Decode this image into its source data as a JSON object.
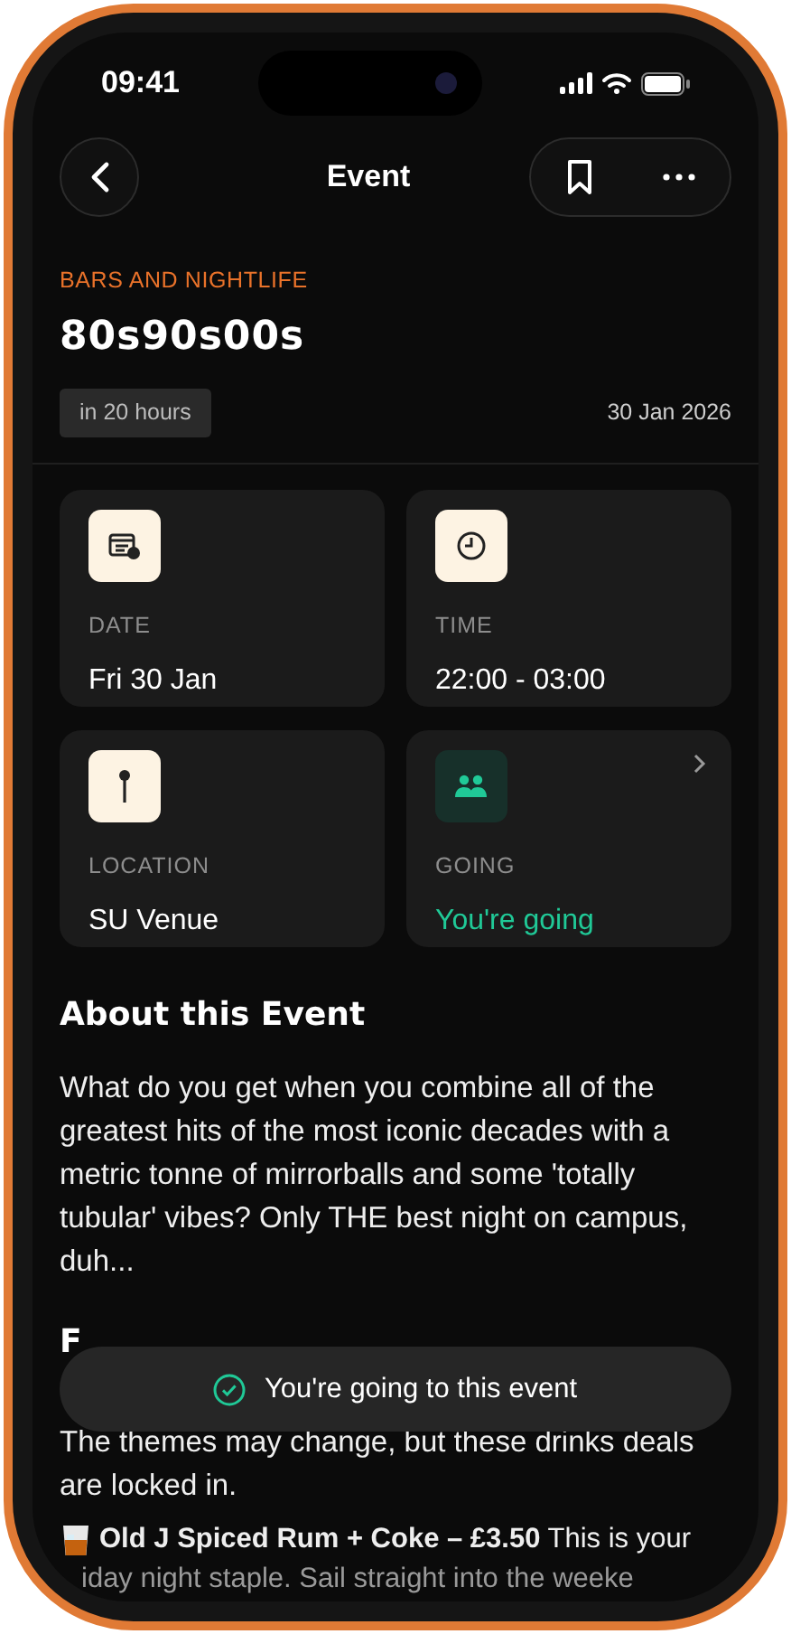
{
  "status_bar": {
    "time": "09:41"
  },
  "nav": {
    "title": "Event"
  },
  "event": {
    "category": "BARS AND NIGHTLIFE",
    "title": "80s90s00s",
    "relative_time": "in 20 hours",
    "date": "30 Jan 2026"
  },
  "info_cards": [
    {
      "kind": "date",
      "label": "DATE",
      "value": "Fri 30 Jan"
    },
    {
      "kind": "time",
      "label": "TIME",
      "value": "22:00 - 03:00"
    },
    {
      "kind": "location",
      "label": "LOCATION",
      "value": "SU Venue"
    },
    {
      "kind": "going",
      "label": "GOING",
      "value": "You're going"
    }
  ],
  "about": {
    "heading": "About this Event",
    "body": "What do you get when you combine all of the greatest hits of the most iconic decades with a metric tonne of mirrorballs and some 'totally tubular' vibes? Only THE best night on campus, duh..."
  },
  "deals": {
    "heading": "F",
    "intro": "The themes may change, but these drinks deals are locked in.",
    "items": [
      {
        "text": "**Old J Spiced Rum + Coke – £3.50** This is your"
      }
    ],
    "cut_line": "iday night staple. Sail straight into the weeke"
  },
  "toast": {
    "text": "You're going to this event"
  }
}
